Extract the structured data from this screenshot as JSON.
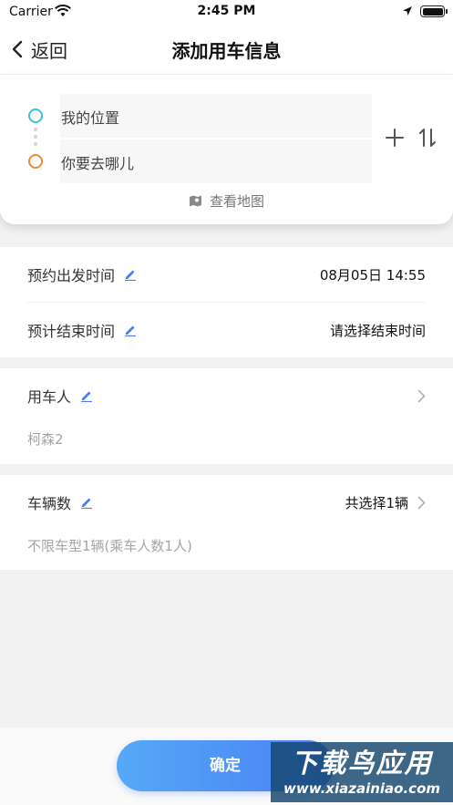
{
  "status_bar": {
    "carrier": "Carrier",
    "time": "2:45 PM"
  },
  "nav": {
    "back_label": "返回",
    "title": "添加用车信息"
  },
  "route": {
    "from_placeholder": "我的位置",
    "to_placeholder": "你要去哪儿",
    "map_link": "查看地图",
    "start_color": "#3cc3cf",
    "end_color": "#f08a34"
  },
  "time_section": {
    "depart_label": "预约出发时间",
    "depart_value": "08月05日 14:55",
    "end_label": "预计结束时间",
    "end_value": "请选择结束时间"
  },
  "user_section": {
    "label": "用车人",
    "value": "柯森2"
  },
  "vehicle_section": {
    "label": "车辆数",
    "value": "共选择1辆",
    "detail": "不限车型1辆(乘车人数1人)"
  },
  "footer": {
    "confirm_label": "确定",
    "accent_color": "#4a7ff6"
  },
  "watermark": {
    "main": "下载鸟应用",
    "sub": "www.xiazainiao.com"
  }
}
